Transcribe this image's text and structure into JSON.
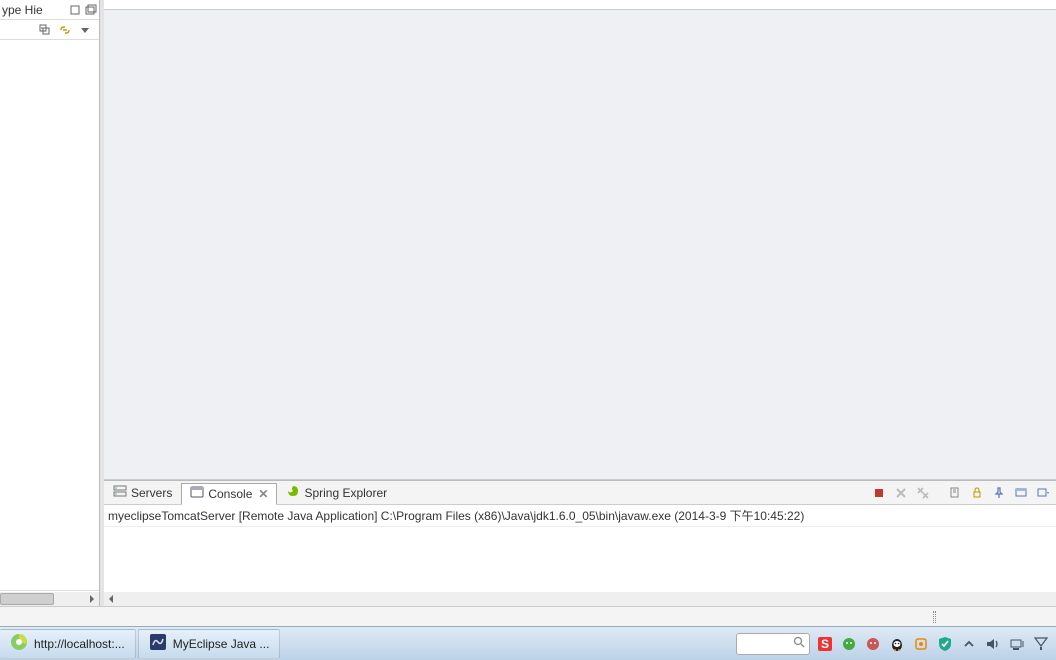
{
  "sidebar": {
    "view_name": "ype Hie"
  },
  "bottom_panel": {
    "tabs": [
      {
        "label": "Servers",
        "active": false
      },
      {
        "label": "Console",
        "active": true
      },
      {
        "label": "Spring Explorer",
        "active": false
      }
    ],
    "console_line": "myeclipseTomcatServer [Remote Java Application] C:\\Program Files (x86)\\Java\\jdk1.6.0_05\\bin\\javaw.exe (2014-3-9 下午10:45:22)"
  },
  "taskbar": {
    "items": [
      {
        "label": "http://localhost:..."
      },
      {
        "label": "MyEclipse Java ..."
      }
    ],
    "search_placeholder": ""
  },
  "colors": {
    "stop_red": "#c0392b",
    "disabled_gray": "#bbbbbb"
  }
}
